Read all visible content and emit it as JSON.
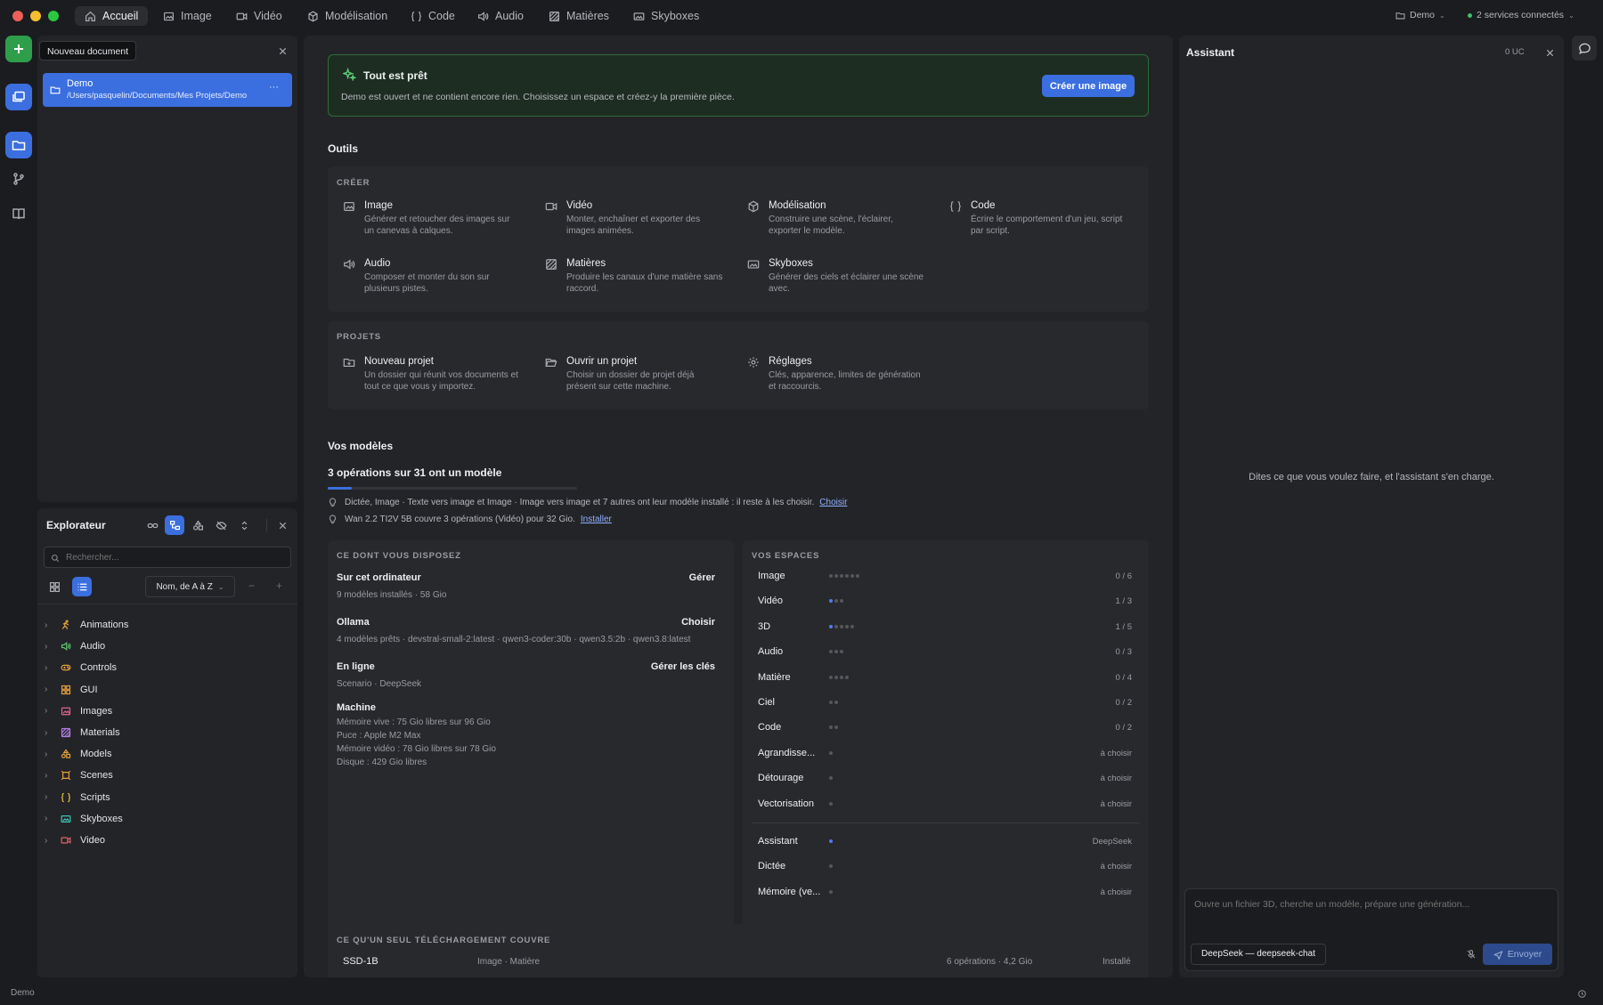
{
  "window": {
    "tabs": [
      {
        "label": "Accueil",
        "icon": "home-icon"
      },
      {
        "label": "Image",
        "icon": "image-icon"
      },
      {
        "label": "Vidéo",
        "icon": "video-icon"
      },
      {
        "label": "Modélisation",
        "icon": "cube-icon"
      },
      {
        "label": "Code",
        "icon": "braces-icon"
      },
      {
        "label": "Audio",
        "icon": "speaker-icon"
      },
      {
        "label": "Matières",
        "icon": "texture-icon"
      },
      {
        "label": "Skyboxes",
        "icon": "panorama-icon"
      }
    ],
    "project_menu": "Demo",
    "services": "2 services connectés"
  },
  "sidebar_top": {
    "tooltip": "Nouveau document",
    "project": {
      "name": "Demo",
      "path": "/Users/pasquelin/Documents/Mes Projets/Demo",
      "more": "···"
    }
  },
  "explorer": {
    "title": "Explorateur",
    "search_placeholder": "Rechercher...",
    "sort_label": "Nom, de A à Z",
    "minus": "−",
    "plus": "+",
    "items": [
      {
        "label": "Animations",
        "icon": "run-icon",
        "color": "#e6a23c"
      },
      {
        "label": "Audio",
        "icon": "speaker-icon",
        "color": "#5cc46b"
      },
      {
        "label": "Controls",
        "icon": "gamepad-icon",
        "color": "#e6a23c"
      },
      {
        "label": "GUI",
        "icon": "grid-icon",
        "color": "#e6a23c"
      },
      {
        "label": "Images",
        "icon": "image-icon",
        "color": "#e0648a"
      },
      {
        "label": "Materials",
        "icon": "texture-icon",
        "color": "#b27ee8"
      },
      {
        "label": "Models",
        "icon": "shapes-icon",
        "color": "#e6a23c"
      },
      {
        "label": "Scenes",
        "icon": "scene-icon",
        "color": "#e6a23c"
      },
      {
        "label": "Scripts",
        "icon": "braces-icon",
        "color": "#e6c23c"
      },
      {
        "label": "Skyboxes",
        "icon": "panorama-icon",
        "color": "#3cc4b4"
      },
      {
        "label": "Video",
        "icon": "video-icon",
        "color": "#e0606a"
      }
    ]
  },
  "banner": {
    "title": "Tout est prêt",
    "text": "Demo est ouvert et ne contient encore rien. Choisissez un espace et créez-y la première pièce.",
    "button": "Créer une image"
  },
  "tools": {
    "heading": "Outils",
    "create_label": "CRÉER",
    "create": [
      {
        "title": "Image",
        "desc1": "Générer et retoucher des images sur",
        "desc2": "un canevas à calques.",
        "icon": "image-icon"
      },
      {
        "title": "Vidéo",
        "desc1": "Monter, enchaîner et exporter des",
        "desc2": "images animées.",
        "icon": "video-icon"
      },
      {
        "title": "Modélisation",
        "desc1": "Construire une scène, l'éclairer,",
        "desc2": "exporter le modèle.",
        "icon": "cube-icon"
      },
      {
        "title": "Code",
        "desc1": "Écrire le comportement d'un jeu, script",
        "desc2": "par script.",
        "icon": "braces-icon"
      },
      {
        "title": "Audio",
        "desc1": "Composer et monter du son sur",
        "desc2": "plusieurs pistes.",
        "icon": "speaker-icon"
      },
      {
        "title": "Matières",
        "desc1": "Produire les canaux d'une matière sans",
        "desc2": "raccord.",
        "icon": "texture-icon"
      },
      {
        "title": "Skyboxes",
        "desc1": "Générer des ciels et éclairer une scène",
        "desc2": "avec.",
        "icon": "panorama-icon"
      }
    ],
    "projects_label": "PROJETS",
    "projects": [
      {
        "title": "Nouveau projet",
        "desc1": "Un dossier qui réunit vos documents et",
        "desc2": "tout ce que vous y importez.",
        "icon": "folder-plus-icon"
      },
      {
        "title": "Ouvrir un projet",
        "desc1": "Choisir un dossier de projet déjà",
        "desc2": "présent sur cette machine.",
        "icon": "folder-open-icon"
      },
      {
        "title": "Réglages",
        "desc1": "Clés, apparence, limites de génération",
        "desc2": "et raccourcis.",
        "icon": "gear-icon"
      }
    ]
  },
  "models": {
    "heading": "Vos modèles",
    "summary": "3 opérations sur 31 ont un modèle",
    "progress": 0.097,
    "hint1": "Dictée, Image · Texte vers image et Image · Image vers image et 7 autres ont leur modèle installé : il reste à les choisir.",
    "hint1_link": "Choisir",
    "hint2": "Wan 2.2 TI2V 5B couvre 3 opérations (Vidéo) pour 32 Gio.",
    "hint2_link": "Installer"
  },
  "have": {
    "label": "CE DONT VOUS DISPOSEZ",
    "computer": {
      "title": "Sur cet ordinateur",
      "action": "Gérer",
      "detail": "9 modèles installés · 58 Gio"
    },
    "ollama": {
      "title": "Ollama",
      "action": "Choisir",
      "detail": "4 modèles prêts · devstral-small-2:latest · qwen3-coder:30b · qwen3.5:2b · qwen3.8:latest"
    },
    "online": {
      "title": "En ligne",
      "action": "Gérer les clés",
      "detail": "Scenario · DeepSeek"
    },
    "machine": {
      "title": "Machine",
      "l1": "Mémoire vive : 75 Gio libres sur 96 Gio",
      "l2": "Puce : Apple M2 Max",
      "l3": "Mémoire vidéo : 78 Gio libres sur 78 Gio",
      "l4": "Disque : 429 Gio libres"
    }
  },
  "spaces": {
    "label": "VOS ESPACES",
    "rows": [
      {
        "name": "Image",
        "value": "0 / 6",
        "on": 0,
        "total": 6
      },
      {
        "name": "Vidéo",
        "value": "1 / 3",
        "on": 1,
        "total": 3
      },
      {
        "name": "3D",
        "value": "1 / 5",
        "on": 1,
        "total": 5
      },
      {
        "name": "Audio",
        "value": "0 / 3",
        "on": 0,
        "total": 3
      },
      {
        "name": "Matière",
        "value": "0 / 4",
        "on": 0,
        "total": 4
      },
      {
        "name": "Ciel",
        "value": "0 / 2",
        "on": 0,
        "total": 2
      },
      {
        "name": "Code",
        "value": "0 / 2",
        "on": 0,
        "total": 2
      },
      {
        "name": "Agrandisse...",
        "value": "à choisir",
        "on": 0,
        "total": 1
      },
      {
        "name": "Détourage",
        "value": "à choisir",
        "on": 0,
        "total": 1
      },
      {
        "name": "Vectorisation",
        "value": "à choisir",
        "on": 0,
        "total": 1
      }
    ],
    "rows2": [
      {
        "name": "Assistant",
        "value": "DeepSeek",
        "on": 1,
        "total": 1
      },
      {
        "name": "Dictée",
        "value": "à choisir",
        "on": 0,
        "total": 1
      },
      {
        "name": "Mémoire (ve...",
        "value": "à choisir",
        "on": 0,
        "total": 1
      }
    ]
  },
  "download": {
    "label": "CE QU'UN SEUL TÉLÉCHARGEMENT COUVRE",
    "name": "SSD-1B",
    "tags": "Image · Matière",
    "ops": "6 opérations · 4,2 Gio",
    "status": "Installé"
  },
  "assistant": {
    "title": "Assistant",
    "credits": "0 UC",
    "empty": "Dites ce que vous voulez faire, et l'assistant s'en charge.",
    "placeholder": "Ouvre un fichier 3D, cherche un modèle, prépare une génération...",
    "model": "DeepSeek — deepseek-chat",
    "send": "Envoyer"
  },
  "statusbar": {
    "project": "Demo"
  },
  "colors": {
    "accent": "#3b6fe0",
    "success_bg": "#1e2d22",
    "success_border": "#2f6b3a"
  }
}
